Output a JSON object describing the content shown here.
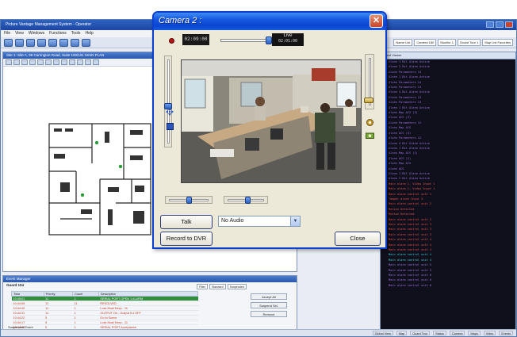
{
  "app": {
    "title": "Picture Vantage Management System - Operator",
    "menu": [
      "File",
      "View",
      "Windows",
      "Functions",
      "Tools",
      "Help"
    ],
    "toolbar_fields": [
      "Name List",
      "Camera 180",
      "Monitor 1",
      "Guard Tour 1",
      "Map List Favorites"
    ]
  },
  "map_panel": {
    "tab_label": "Site 1: Site A, 99 Carrington Road, Suite 100/101 MAIN PLAN"
  },
  "event_log": {
    "header": "Event Viewer",
    "lines": [
      {
        "text": "Alarm 1 Bit Alarm Active",
        "color": "#9b6fe0"
      },
      {
        "text": "Alarm 2 Bit Alarm Active",
        "color": "#9b6fe0"
      },
      {
        "text": "Alarm Parameters 14",
        "color": "#9b6fe0"
      },
      {
        "text": "Alarm 1 Bit Alarm Active",
        "color": "#9b6fe0"
      },
      {
        "text": "Alarm Parameters 14",
        "color": "#9b6fe0"
      },
      {
        "text": "Alarm Parameters 14",
        "color": "#9b6fe0"
      },
      {
        "text": "Alarm 4 Bit Alarm Active",
        "color": "#9b6fe0"
      },
      {
        "text": "Alarm Parameters 13",
        "color": "#9b6fe0"
      },
      {
        "text": "Alarm Parameters 13",
        "color": "#9b6fe0"
      },
      {
        "text": "Alarm 1 Bit Alarm Active",
        "color": "#9b6fe0"
      },
      {
        "text": "Alarm Map ACS (3)",
        "color": "#9b6fe0"
      },
      {
        "text": "Alarm ACS (3)",
        "color": "#9b6fe0"
      },
      {
        "text": "Alarm Parameters 12",
        "color": "#9b6fe0"
      },
      {
        "text": "Alarm Map ACS",
        "color": "#9b6fe0"
      },
      {
        "text": "Alarm ACS (3)",
        "color": "#9b6fe0"
      },
      {
        "text": "Alarm Parameters 12",
        "color": "#9b6fe0"
      },
      {
        "text": "Alarm 4 Bit Alarm Active",
        "color": "#9b6fe0"
      },
      {
        "text": "Alarm 1 Bit Alarm Active",
        "color": "#9b6fe0"
      },
      {
        "text": "Alarm Map ACS (2)",
        "color": "#9b6fe0"
      },
      {
        "text": "Alarm ACS (2)",
        "color": "#9b6fe0"
      },
      {
        "text": "Alarm Map ACS",
        "color": "#9b6fe0"
      },
      {
        "text": "Alarm ACS",
        "color": "#9b6fe0"
      },
      {
        "text": "Alarm 1 Bit Alarm Active",
        "color": "#9b6fe0"
      },
      {
        "text": "Alarm 2 Bit Alarm Active",
        "color": "#9b6fe0"
      },
      {
        "text": "Main alarm 1, Video Input 1",
        "color": "#e84b4b"
      },
      {
        "text": "Main alarm 1, Video Input 1",
        "color": "#e84b4b"
      },
      {
        "text": "Main alarm control unit 1",
        "color": "#e84b4b"
      },
      {
        "text": "Tamper alarm Input 3",
        "color": "#e84b4b"
      },
      {
        "text": "Main alarm control unit 2",
        "color": "#e84b4b"
      },
      {
        "text": "Motion Detected",
        "color": "#e84b4b"
      },
      {
        "text": "Motion Detected",
        "color": "#e84b4b"
      },
      {
        "text": "Main alarm control unit 2",
        "color": "#e84b4b"
      },
      {
        "text": "Main alarm control unit 3",
        "color": "#e84b4b"
      },
      {
        "text": "Main alarm control unit 3",
        "color": "#e84b4b"
      },
      {
        "text": "Main alarm control unit 3",
        "color": "#e84b4b"
      },
      {
        "text": "Main alarm control unit 4",
        "color": "#e84b4b"
      },
      {
        "text": "Main alarm control unit 4",
        "color": "#e84b4b"
      },
      {
        "text": "Main alarm control unit 4",
        "color": "#e84b4b"
      },
      {
        "text": "Main alarm control unit 4",
        "color": "#36c9d4"
      },
      {
        "text": "Main alarm control unit 4",
        "color": "#36c9d4"
      },
      {
        "text": "Main alarm control unit 5",
        "color": "#9b6fe0"
      },
      {
        "text": "Main alarm control unit 5",
        "color": "#9b6fe0"
      },
      {
        "text": "Main alarm control unit 6",
        "color": "#9b6fe0"
      },
      {
        "text": "Main alarm control unit 6",
        "color": "#9b6fe0"
      },
      {
        "text": "Main alarm control unit 6",
        "color": "#9b6fe0"
      }
    ]
  },
  "event_manager": {
    "title": "Event Manager",
    "subtitle": "Guard 104",
    "filter": [
      "Filter",
      "Standard",
      "Suspended"
    ],
    "columns": [
      "Time",
      "Priority",
      "Count",
      "Description"
    ],
    "rows": [
      {
        "time": "10:45:01",
        "priority": "11",
        "count": "1",
        "description": "SERIAL PORT OPEN 1 ALARM",
        "color": "#ffffff",
        "selected": true
      },
      {
        "time": "10:44:55",
        "priority": "11",
        "count": "11",
        "description": "RESOLVED",
        "color": "#c43a1e",
        "selected": false
      },
      {
        "time": "10:44:40",
        "priority": "11",
        "count": "1",
        "description": "Loss Must Keep - 11",
        "color": "#c43a1e",
        "selected": false
      },
      {
        "time": "10:44:31",
        "priority": "11",
        "count": "1",
        "description": "OUTPUT On - Output 5.4 OFF",
        "color": "#c43a1e",
        "selected": false
      },
      {
        "time": "10:44:22",
        "priority": "5",
        "count": "1",
        "description": "Go to Scene",
        "color": "#c43a1e",
        "selected": false
      },
      {
        "time": "10:44:17",
        "priority": "5",
        "count": "1",
        "description": "Loss Must Keep - 11",
        "color": "#c43a1e",
        "selected": false
      },
      {
        "time": "10:44:09",
        "priority": "5",
        "count": "1",
        "description": "SERIAL PORT Acceptance",
        "color": "#c43a1e",
        "selected": false
      }
    ],
    "buttons": [
      "Accept All",
      "Suspend Sel.",
      "Remove"
    ],
    "comment_label": "Suspended Event",
    "input_button": "Add",
    "tabs": [
      "Messages",
      "Event Manager"
    ]
  },
  "statusbar": [
    "Global View",
    "Map",
    "Guard Tour",
    "Status",
    "Camera",
    "Maps",
    "Video",
    "Events"
  ],
  "camera_dialog": {
    "title": "Camera 2 :",
    "time_display": "02:09:00",
    "live_label": "Live",
    "live_time": "02:01:00",
    "scrub_position": 1.0,
    "volume_left_level": 0.45,
    "volume_right_level": 0.1,
    "slider_a_position": 0.5,
    "slider_b_position": 0.55,
    "talk_label": "Talk",
    "audio_select_value": "No Audio",
    "record_label": "Record to DVR",
    "close_label": "Close"
  },
  "colors": {
    "dialog_title_bar": "#1657e0",
    "dialog_close": "#c8462a",
    "event_log_bg": "#10101c",
    "selected_row": "#2f8f3e"
  },
  "icons": [
    "close-icon",
    "record-dot-icon",
    "ptz-arrows-icon",
    "zoom-icon",
    "speaker-icon",
    "gear-icon",
    "snapshot-icon"
  ]
}
